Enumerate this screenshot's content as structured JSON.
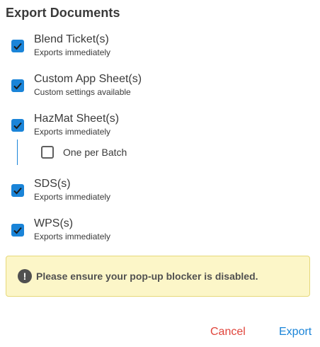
{
  "dialog": {
    "title": "Export Documents"
  },
  "options": [
    {
      "label": "Blend Ticket(s)",
      "sub": "Exports immediately",
      "checked": true
    },
    {
      "label": "Custom App Sheet(s)",
      "sub": "Custom settings available",
      "checked": true
    },
    {
      "label": "HazMat Sheet(s)",
      "sub": "Exports immediately",
      "checked": true
    },
    {
      "label": "SDS(s)",
      "sub": "Exports immediately",
      "checked": true
    },
    {
      "label": "WPS(s)",
      "sub": "Exports immediately",
      "checked": true
    }
  ],
  "hazmat_sub_option": {
    "label": "One per Batch",
    "checked": false
  },
  "notice": {
    "icon": "exclamation-circle-icon",
    "text": "Please ensure your pop-up blocker is disabled."
  },
  "actions": {
    "cancel_label": "Cancel",
    "export_label": "Export"
  },
  "colors": {
    "accent": "#1a84d8",
    "cancel": "#e0443b",
    "notice_bg": "#fcf6c8",
    "notice_border": "#e6d87a"
  }
}
